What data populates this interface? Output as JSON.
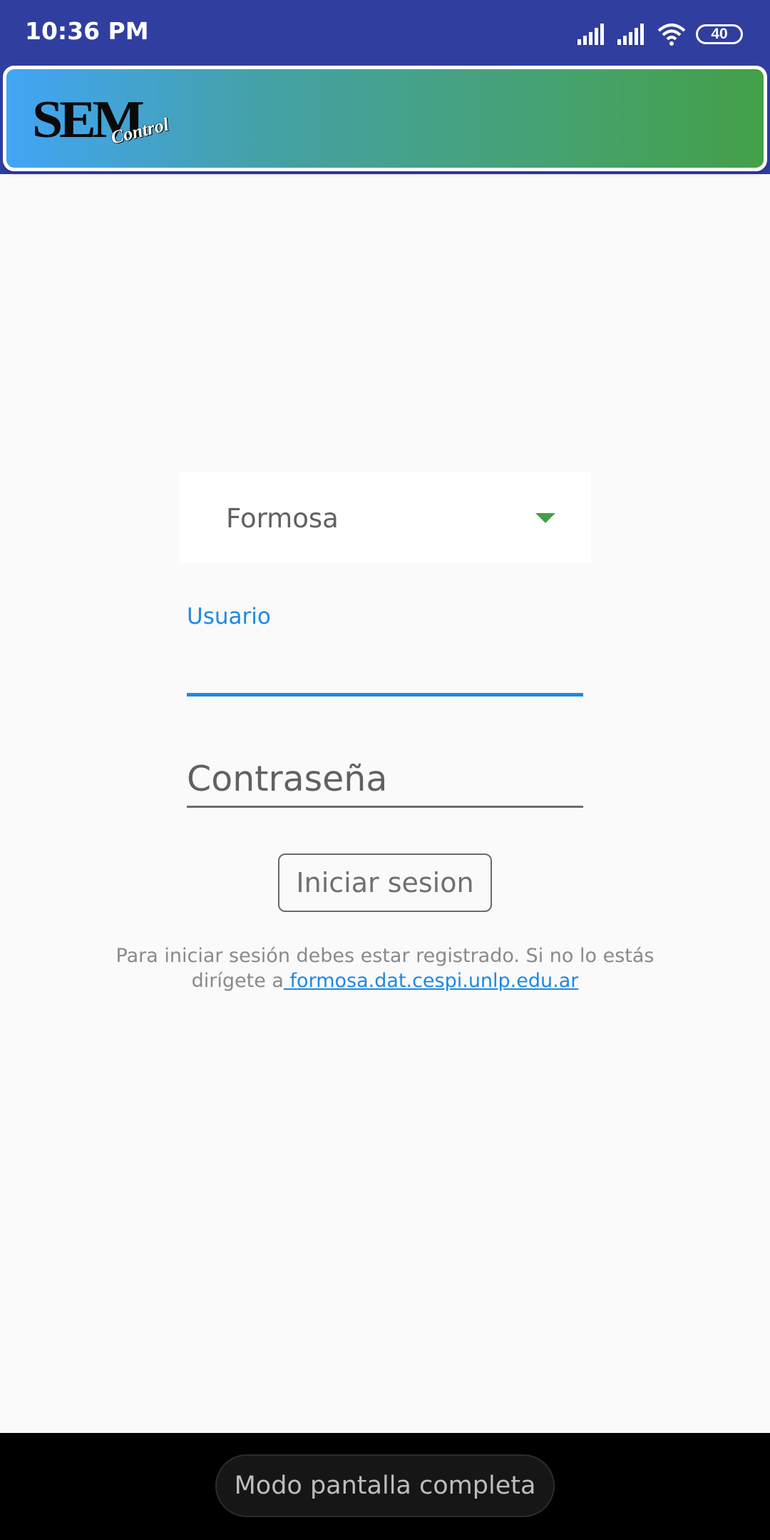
{
  "status_bar": {
    "time": "10:36 PM",
    "battery": "40",
    "icons": [
      "signal-icon",
      "signal-icon",
      "wifi-icon",
      "battery-icon"
    ]
  },
  "header": {
    "logo_main": "SEM",
    "logo_sub": "Control",
    "colors": {
      "gradient_start": "#42a5f5",
      "gradient_end": "#43a047",
      "status_bar": "#303f9f"
    }
  },
  "form": {
    "city_selected": "Formosa",
    "username_label": "Usuario",
    "username_value": "",
    "password_placeholder": "Contraseña",
    "login_button": "Iniciar sesion"
  },
  "info": {
    "text": "Para iniciar sesión debes estar registrado. Si no lo estás dirígete a",
    "link": " formosa.dat.cespi.unlp.edu.ar"
  },
  "system": {
    "fullscreen_mode": "Modo pantalla completa"
  },
  "accent": {
    "primary": "#1e88e5",
    "dropdown_arrow": "#43a047"
  }
}
